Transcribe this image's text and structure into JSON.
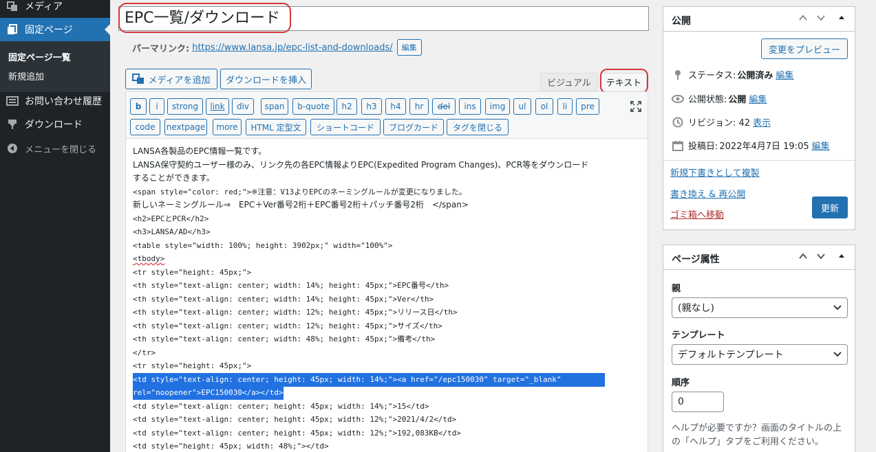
{
  "sidebar": {
    "media_label": "メディア",
    "pages_label": "固定ページ",
    "submenu_all": "固定ページ一覧",
    "submenu_new": "新規追加",
    "contact_label": "お問い合わせ履歴",
    "download_label": "ダウンロード",
    "collapse_label": "メニューを閉じる"
  },
  "editor": {
    "title": "EPC一覧/ダウンロード",
    "permalink_label": "パーマリンク:",
    "permalink_url": "https://www.lansa.jp/epc-list-and-downloads/",
    "permalink_edit": "編集",
    "add_media": "メディアを追加",
    "insert_download": "ダウンロードを挿入",
    "tab_visual": "ビジュアル",
    "tab_text": "テキスト",
    "quicktags": [
      "b",
      "i",
      "strong",
      "link",
      "div",
      "span",
      "b-quote",
      "h2",
      "h3",
      "h4",
      "hr",
      "del",
      "ins",
      "img",
      "ul",
      "ol",
      "li",
      "pre",
      "code",
      "nextpage",
      "more",
      "HTML 定型文",
      "ショートコード",
      "ブログカード",
      "タグを閉じる"
    ],
    "code_lines": [
      "LANSA各製品のEPC情報一覧です。",
      "LANSA保守契約ユーザー様のみ、リンク先の各EPC情報よりEPC(Expedited Program Changes)、PCR等をダウンロード",
      "することができます。",
      "<span style=\"color: red;\">※注意：V13よりEPCのネーミングルールが変更になりました。",
      "新しいネーミングルール⇒　EPC＋Ver番号2桁＋EPC番号2桁＋パッチ番号2桁　</span>",
      "<h2>EPCとPCR</h2>",
      "<h3>LANSA/AD</h3>",
      "<table style=\"width: 100%; height: 3902px;\" width=\"100%\">",
      "<tbody>",
      "<tr style=\"height: 45px;\">",
      "<th style=\"text-align: center; width: 14%; height: 45px;\">EPC番号</th>",
      "<th style=\"text-align: center; width: 14%; height: 45px;\">Ver</th>",
      "<th style=\"text-align: center; width: 12%; height: 45px;\">リリース日</th>",
      "<th style=\"text-align: center; width: 12%; height: 45px;\">サイズ</th>",
      "<th style=\"text-align: center; width: 48%; height: 45px;\">備考</th>",
      "</tr>",
      "<tr style=\"height: 45px;\">",
      "<td style=\"text-align: center; height: 45px; width: 14%;\"><a href=\"/epc150030\" target=\"_blank\"",
      "rel=\"noopener\">EPC150030</a></td>",
      "<td style=\"text-align: center; height: 45px; width: 14%;\">15</td>",
      "<td style=\"text-align: center; height: 45px; width: 12%;\">2021/4/2</td>",
      "<td style=\"text-align: center; height: 45px; width: 12%;\">192,083KB</td>",
      "<td style=\"height: 45px; width: 48%;\"></td>"
    ]
  },
  "publish": {
    "title": "公開",
    "preview_button": "変更をプレビュー",
    "status_label": "ステータス:",
    "status_value": "公開済み",
    "status_edit": "編集",
    "visibility_label": "公開状態:",
    "visibility_value": "公開",
    "visibility_edit": "編集",
    "revision_label": "リビジョン: 42",
    "revision_link": "表示",
    "date_label": "投稿日:",
    "date_value": "2022年4月7日 19:05",
    "date_edit": "編集",
    "duplicate_link": "新規下書きとして複製",
    "rewrite_link": "書き換え & 再公開",
    "trash_link": "ゴミ箱へ移動",
    "update_button": "更新"
  },
  "page_attributes": {
    "title": "ページ属性",
    "parent_label": "親",
    "parent_value": "(親なし)",
    "template_label": "テンプレート",
    "template_value": "デフォルトテンプレート",
    "order_label": "順序",
    "order_value": "0",
    "help_text": "ヘルプが必要ですか？画面のタイトルの上の「ヘルプ」タブをご利用ください。"
  },
  "colors": {
    "accent": "#2271b1",
    "sidebar_bg": "#1d2327",
    "annotation_red": "#d63638",
    "selection": "#2271e0"
  }
}
